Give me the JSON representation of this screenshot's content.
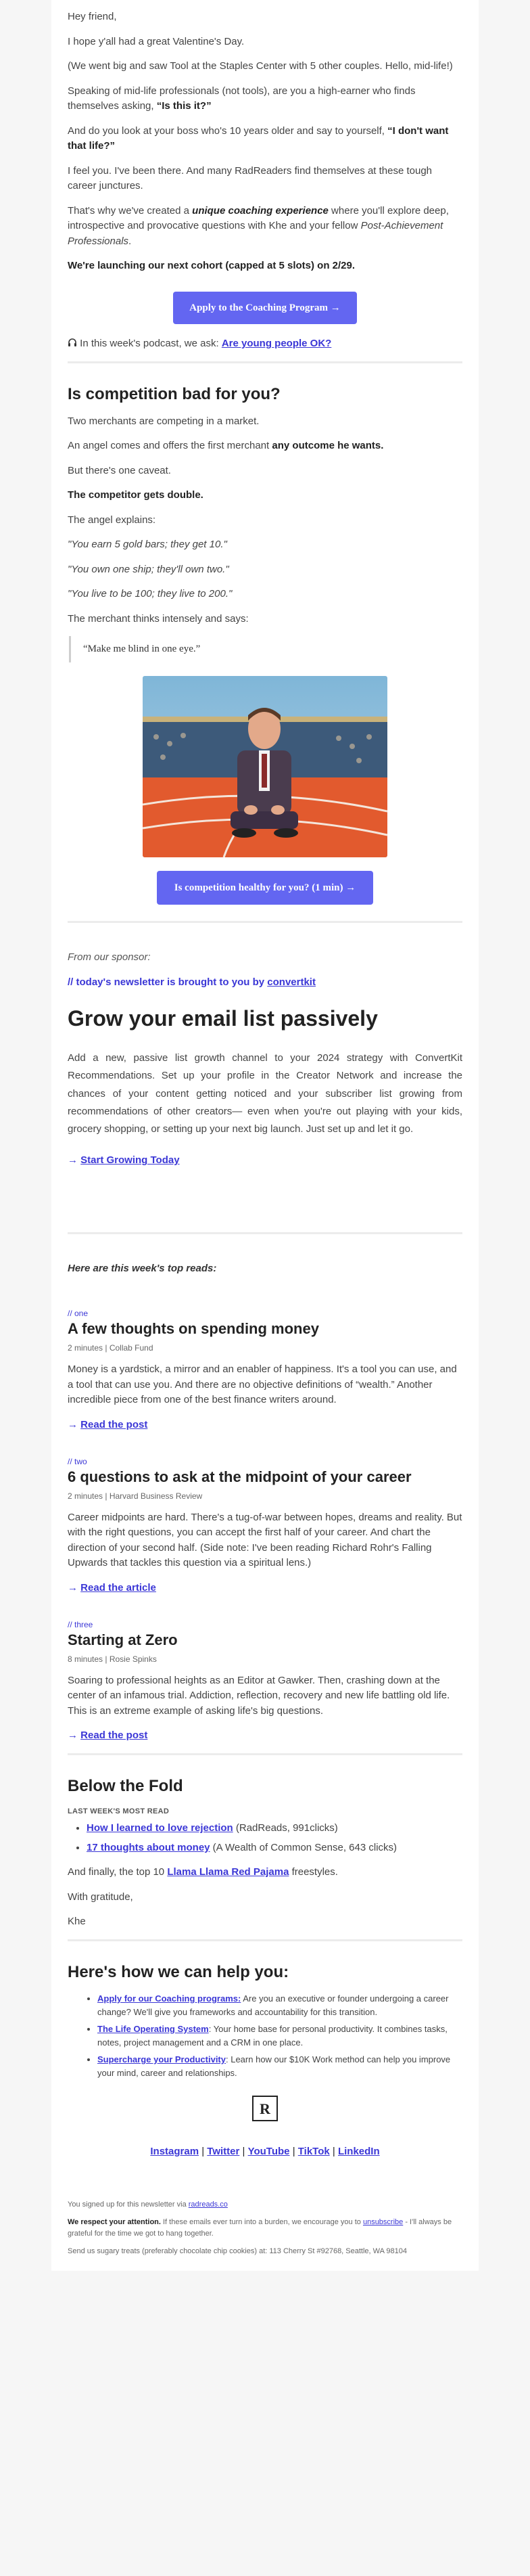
{
  "intro": {
    "greeting": "Hey friend,",
    "p1": "I hope y'all had a great Valentine's Day.",
    "p2": "(We went big and saw Tool at the Staples Center with 5 other couples. Hello, mid-life!)",
    "p3_pre": "Speaking of mid-life professionals (not tools), are you a high-earner who finds themselves asking, ",
    "p3_bold": "“Is this it?”",
    "p4_pre": "And do you look at your boss who's 10 years older and say to yourself, ",
    "p4_bold": "“I don't want that life?”",
    "p5": "I feel you. I've been there. And many RadReaders find themselves at these tough career junctures.",
    "p6_pre": "That's why we've created a ",
    "p6_bold_italic": "unique coaching experience",
    "p6_mid": " where you'll explore deep, introspective and provocative questions with Khe and your fellow ",
    "p6_italic": "Post-Achievement Professionals",
    "p6_end": ".",
    "p7_bold": "We're launching our next cohort (capped at 5 slots) on 2/29.",
    "cta": "Apply to the Coaching Program →",
    "podcast_pre": "In this week's podcast, we ask: ",
    "podcast_link": "Are young people OK?"
  },
  "competition": {
    "title": "Is competition bad for you?",
    "p1": "Two merchants are competing in a market.",
    "p2_pre": "An angel comes and offers the first merchant ",
    "p2_bold": "any outcome he wants.",
    "p3": "But there's one caveat.",
    "p4_bold": "The competitor gets double.",
    "p5": "The angel explains:",
    "q1": "\"You earn 5 gold bars; they get 10.\"",
    "q2": "\"You own one ship; they'll own two.\"",
    "q3": "\"You live to be 100; they live to 200.\"",
    "p6": "The merchant thinks intensely and says:",
    "blockquote": "“Make me blind in one eye.”",
    "cta": "Is competition healthy for you? (1 min) →"
  },
  "sponsor": {
    "from": "From our sponsor:",
    "brought_pre": "// today's newsletter is brought to you by ",
    "brought_link": "convertkit",
    "headline": "Grow your email list passively",
    "body": "Add a new, passive list growth channel to your 2024 strategy with ConvertKit Recommendations. Set up your profile in the Creator Network and increase the chances of your content getting noticed and your subscriber list growing from recommendations of other creators— even when you're out playing with your kids, grocery shopping, or setting up your next big launch. Just set up and let it go.",
    "cta_arrow": "→ ",
    "cta_link": "Start Growing Today"
  },
  "reads": {
    "intro": "Here are this week's top reads:",
    "items": [
      {
        "num": "// one",
        "title": "A few thoughts on spending money",
        "minutes": "2 minutes | ",
        "source": "Collab Fund",
        "body": "Money is a yardstick, a mirror and an enabler of happiness. It's a tool you can use, and a tool that can use you. And there are no objective definitions of “wealth.” Another incredible piece from one of the best finance writers around.",
        "arrow": "→ ",
        "link": "Read the post"
      },
      {
        "num": "// two",
        "title": "6 questions to ask at the midpoint of your career",
        "minutes": "2 minutes | ",
        "source": "Harvard Business Review",
        "body": "Career midpoints are hard. There's a tug-of-war between hopes, dreams and reality. But with the right questions, you can accept the first half of your career. And chart the direction of your second half. (Side note: I've been reading Richard Rohr's Falling Upwards that tackles this question via a spiritual lens.)",
        "arrow": "→ ",
        "link": "Read the article"
      },
      {
        "num": "// three",
        "title": "Starting at Zero",
        "minutes": "8 minutes | ",
        "source": "Rosie Spinks",
        "body": "Soaring to professional heights as an Editor at Gawker. Then, crashing down at the center of an infamous trial. Addiction, reflection, recovery and new life battling old life. This is an extreme example of asking life's big questions.",
        "arrow": "→ ",
        "link": "Read the post"
      }
    ]
  },
  "fold": {
    "title": "Below the Fold",
    "label": "LAST WEEK'S MOST READ",
    "items": [
      {
        "link": "How I learned to love rejection",
        "note": " (RadReads, 991clicks)"
      },
      {
        "link": "17 thoughts about money",
        "note": " (A Wealth of Common Sense, 643 clicks)"
      }
    ],
    "finally_pre": "And finally, the top 10 ",
    "finally_link": "Llama Llama Red Pajama",
    "finally_post": " freestyles.",
    "gratitude": "With gratitude,",
    "signoff": "Khe"
  },
  "help": {
    "title": "Here's how we can help you:",
    "items": [
      {
        "link": "Apply for our Coaching programs:",
        "text": " Are you an executive or founder undergoing a career change? We'll give you frameworks and accountability for this transition."
      },
      {
        "link": "The Life Operating System",
        "text": ": Your home base for personal productivity. It combines tasks, notes, project management and a CRM in one place."
      },
      {
        "link": "Supercharge your Productivity",
        "text": ": Learn how our $10K Work method can help you improve your mind, career and relationships."
      }
    ],
    "logo": "R"
  },
  "social": {
    "instagram": "Instagram",
    "twitter": "Twitter",
    "youtube": "YouTube",
    "tiktok": "TikTok",
    "linkedin": "LinkedIn",
    "sep": " | "
  },
  "footer": {
    "signed_pre": "You signed up for this newsletter via ",
    "signed_link": "radreads.co",
    "respect_bold": "We respect your attention.",
    "respect_mid": " If these emails ever turn into a burden, we encourage you to ",
    "unsubscribe": "unsubscribe",
    "respect_end": " - I'll always be grateful for the time we got to hang together.",
    "address": "Send us sugary treats (preferably chocolate chip cookies) at: 113 Cherry St #92768, Seattle, WA 98104"
  },
  "colors": {
    "accent": "#6366f1",
    "link": "#3b37d6"
  }
}
